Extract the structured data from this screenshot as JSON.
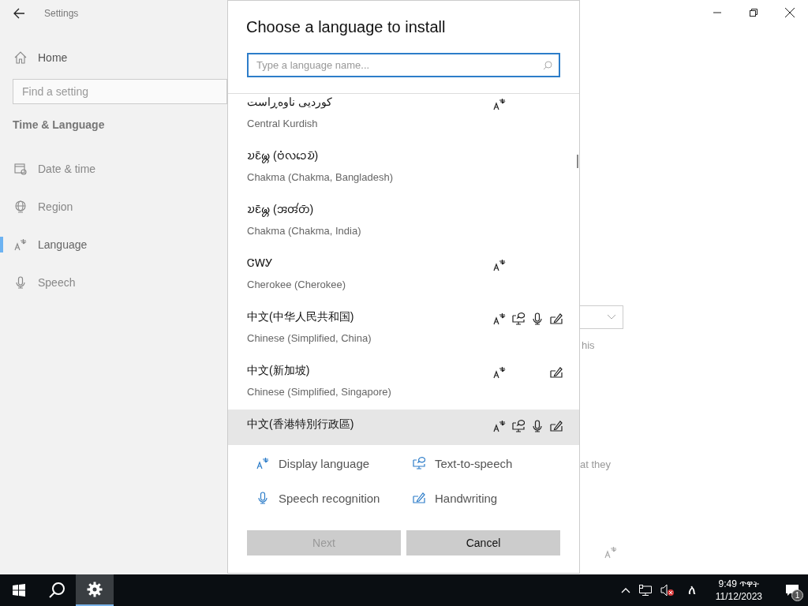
{
  "window": {
    "title": "Settings"
  },
  "sidebar": {
    "home": "Home",
    "search": {
      "placeholder": "Find a setting"
    },
    "section": "Time & Language",
    "items": [
      {
        "kind": "date",
        "label": "Date & time",
        "selected": false
      },
      {
        "kind": "region",
        "label": "Region",
        "selected": false
      },
      {
        "kind": "language",
        "label": "Language",
        "selected": true
      },
      {
        "kind": "speech",
        "label": "Speech",
        "selected": false
      }
    ]
  },
  "main_fragments": [
    "his",
    "at they"
  ],
  "dialog": {
    "title": "Choose a language to install",
    "search": {
      "placeholder": "Type a language name..."
    },
    "languages": [
      {
        "native": "کوردیی ناوەڕاست",
        "english": "Central Kurdish",
        "display": true,
        "tts": false,
        "speech": false,
        "handwriting": false,
        "hovered": false
      },
      {
        "native": "𑄌𑄋𑄴𑄟𑄳𑄦 (𑄝𑄁𑄣𑄘𑄬𑄌𑄴)",
        "english": "Chakma (Chakma, Bangladesh)",
        "display": false,
        "tts": false,
        "speech": false,
        "handwriting": false,
        "hovered": false
      },
      {
        "native": "𑄌𑄋𑄴𑄟𑄳𑄦 (𑄞𑄢𑄧𑄖𑄴)",
        "english": "Chakma (Chakma, India)",
        "display": false,
        "tts": false,
        "speech": false,
        "handwriting": false,
        "hovered": false
      },
      {
        "native": "ᏣᎳᎩ",
        "english": "Cherokee (Cherokee)",
        "display": true,
        "tts": false,
        "speech": false,
        "handwriting": false,
        "hovered": false
      },
      {
        "native": "中文(中华人民共和国)",
        "english": "Chinese (Simplified, China)",
        "display": true,
        "tts": true,
        "speech": true,
        "handwriting": true,
        "hovered": false
      },
      {
        "native": "中文(新加坡)",
        "english": "Chinese (Simplified, Singapore)",
        "display": true,
        "tts": false,
        "speech": false,
        "handwriting": true,
        "hovered": false
      },
      {
        "native": "中文(香港特別行政區)",
        "display": true,
        "tts": true,
        "speech": true,
        "handwriting": true,
        "hovered": true
      }
    ],
    "legend": [
      {
        "kind": "display",
        "label": "Display language"
      },
      {
        "kind": "tts",
        "label": "Text-to-speech"
      },
      {
        "kind": "speech",
        "label": "Speech recognition"
      },
      {
        "kind": "handwriting",
        "label": "Handwriting"
      }
    ],
    "buttons": [
      {
        "label": "Next",
        "disabled": true
      },
      {
        "label": "Cancel",
        "disabled": false
      }
    ]
  },
  "taskbar": {
    "apps": [
      {
        "kind": "start",
        "active": false
      },
      {
        "kind": "search",
        "active": false
      },
      {
        "kind": "settings",
        "active": true
      }
    ],
    "ime": "ለ",
    "time": "9:49 ጥዋት",
    "date": "11/12/2023",
    "notifications": "1"
  }
}
